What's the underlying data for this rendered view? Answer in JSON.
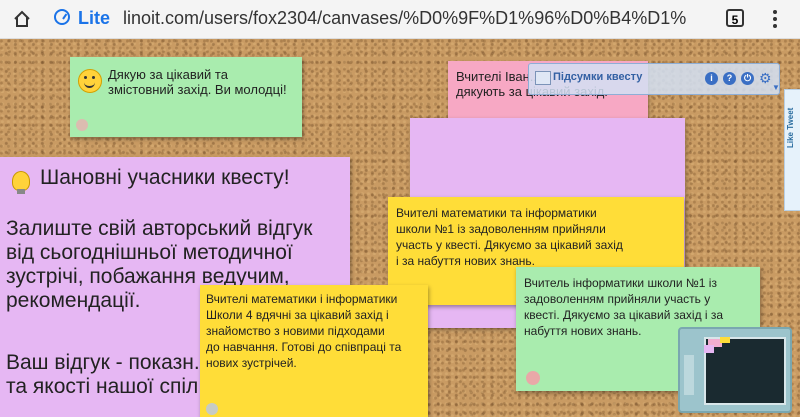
{
  "browser": {
    "lite_label": "Lite",
    "url": "linoit.com/users/fox2304/canvases/%D0%9F%D1%96%D0%B4%D1%",
    "tab_count": "5"
  },
  "notes": {
    "green_thanks": "Дякую за цікавий та\nзмістовний захід. Ви молодці!",
    "pink_top": "Вчителі Іван...\nдякують за цікавий захід.",
    "main": {
      "heading": "Шановні учасники квесту!",
      "body": "Залиште свій авторський відгук\nвід сьогоднішньої методичної\nзустрічі, побажання ведучим,\nрекомендації.",
      "body2": "Ваш відгук - показн...\nта якості нашої спіл..."
    },
    "yellow_mid": "Вчителі математики та інформатики\nшколи №1 із задоволенням прийняли\nучасть у квесті. Дякуємо за цікавий захід\nі за набуття нових знань.",
    "green_school1": "Вчитель інформатики школи №1 із\nзадоволенням прийняли участь у\nквесті. Дякуємо за цікавий захід і за\nнабуття нових знань.",
    "yellow_school4": "Вчителі математики і інформатики\nШколи 4 вдячні за цікавий захід і\nзнайомство з новими підходами\nдо навчання. Готові до співпраці та\nнових зустрічей."
  },
  "summary": {
    "title": "Підсумки квесту"
  },
  "side_tab": {
    "label": "Like  Tweet"
  },
  "colors": {
    "cork": "#c99b63",
    "note_green": "#a9ecae",
    "note_pink": "#f7a8c4",
    "note_violet": "#e6b7f3",
    "note_yellow": "#ffdd38",
    "accent_blue": "#1a73e8"
  }
}
